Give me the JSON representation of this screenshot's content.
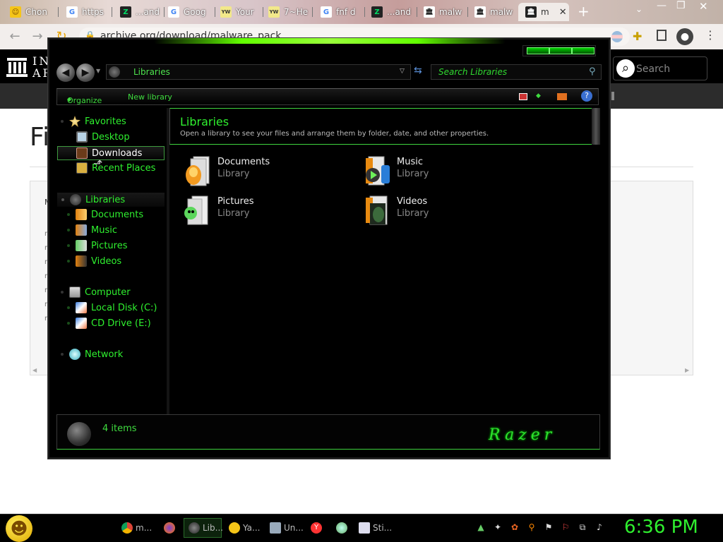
{
  "browser": {
    "tabs": [
      {
        "title": "Chon",
        "favicon": "sponge-icon",
        "color": "#f5c518"
      },
      {
        "title": "https",
        "favicon": "google-icon",
        "color": "#ffffff"
      },
      {
        "title": "...and",
        "favicon": "z-icon",
        "color": "#0b3"
      },
      {
        "title": "Goog",
        "favicon": "google-icon",
        "color": "#ffffff"
      },
      {
        "title": "Your",
        "favicon": "yw-icon",
        "color": "#f2e88a"
      },
      {
        "title": "7~He",
        "favicon": "yw-icon",
        "color": "#f2e88a"
      },
      {
        "title": "fnf d",
        "favicon": "google-icon",
        "color": "#ffffff"
      },
      {
        "title": "...and",
        "favicon": "z-icon",
        "color": "#0b3"
      },
      {
        "title": "malw",
        "favicon": "archive-icon",
        "color": "#ffffff"
      },
      {
        "title": "malw",
        "favicon": "archive-icon",
        "color": "#ffffff"
      },
      {
        "title": "m",
        "favicon": "archive-icon",
        "color": "#222222"
      }
    ],
    "url": "archive.org/download/malware_pack",
    "new_tab": "+"
  },
  "site": {
    "logo_line1": "IN",
    "logo_line2": "AR",
    "search_placeholder": "Search",
    "page_title": "Fi",
    "rows": [
      "M",
      "m",
      "m",
      "m",
      "m",
      "m",
      "m",
      "m"
    ]
  },
  "explorer": {
    "address": "Libraries",
    "search_placeholder": "Search Libraries",
    "toolbar": {
      "organize": "Organize",
      "new_library": "New library",
      "help": "?"
    },
    "nav": {
      "favorites": "Favorites",
      "desktop": "Desktop",
      "downloads": "Downloads",
      "recent": "Recent Places",
      "libraries": "Libraries",
      "documents": "Documents",
      "music": "Music",
      "pictures": "Pictures",
      "videos": "Videos",
      "computer": "Computer",
      "local_disk": "Local Disk (C:)",
      "cd_drive": "CD Drive (E:)",
      "network": "Network"
    },
    "header": {
      "title": "Libraries",
      "subtitle": "Open a library to see your files and arrange them by folder, date, and other properties."
    },
    "libraries": [
      {
        "name": "Documents",
        "kind": "Library"
      },
      {
        "name": "Music",
        "kind": "Library"
      },
      {
        "name": "Pictures",
        "kind": "Library"
      },
      {
        "name": "Videos",
        "kind": "Library"
      }
    ],
    "status": "4 items",
    "brand": "Razer"
  },
  "taskbar": {
    "items": [
      {
        "label": "m...",
        "icon": "chrome-icon"
      },
      {
        "label": "",
        "icon": "firefox-icon"
      },
      {
        "label": "Lib...",
        "icon": "explorer-icon"
      },
      {
        "label": "Ya...",
        "icon": "yahoo-icon"
      },
      {
        "label": "Un...",
        "icon": "notepad-icon"
      },
      {
        "label": "",
        "icon": "yandex-icon"
      },
      {
        "label": "",
        "icon": "app-icon"
      },
      {
        "label": "Sti...",
        "icon": "sticky-icon"
      }
    ],
    "clock": "6:36 PM"
  },
  "colors": {
    "accent": "#2ff02f",
    "window_bg": "#000000"
  }
}
